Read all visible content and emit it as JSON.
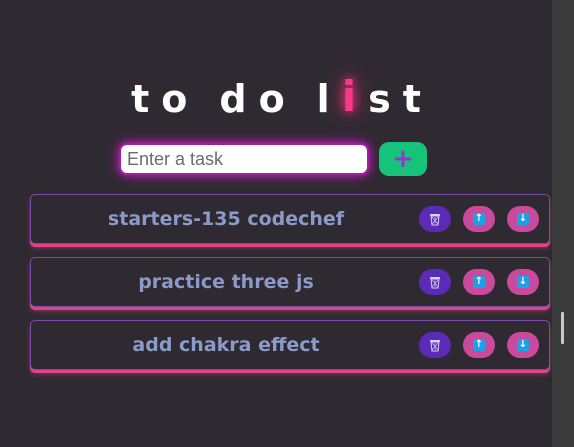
{
  "title": {
    "letters_word1": [
      "t",
      "o"
    ],
    "letters_word2": [
      "d",
      "o"
    ],
    "letters_word3": [
      "l",
      "i",
      "s",
      "t"
    ]
  },
  "input": {
    "placeholder": "Enter a task",
    "value": ""
  },
  "add_button": {
    "label": "+"
  },
  "tasks": [
    {
      "text": "starters-135 codechef"
    },
    {
      "text": "practice three js"
    },
    {
      "text": "add chakra effect"
    }
  ],
  "icons": {
    "delete": "trash-icon",
    "up": "arrow-up-icon",
    "down": "arrow-down-icon"
  },
  "colors": {
    "background": "#2f2a31",
    "accent_pink": "#f53a86",
    "add_green": "#16c37a",
    "task_text": "#8a9bc9",
    "delete_purple": "#5b2bb8",
    "move_pink": "#c94a9c"
  }
}
